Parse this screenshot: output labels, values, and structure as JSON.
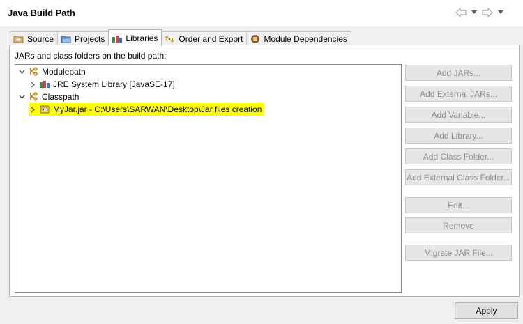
{
  "window": {
    "title": "Java Build Path"
  },
  "tabs": [
    {
      "label": "Source",
      "icon": "source-folder-icon",
      "active": false
    },
    {
      "label": "Projects",
      "icon": "projects-icon",
      "active": false
    },
    {
      "label": "Libraries",
      "icon": "libraries-icon",
      "active": true
    },
    {
      "label": "Order and Export",
      "icon": "order-export-icon",
      "active": false
    },
    {
      "label": "Module Dependencies",
      "icon": "module-dependencies-icon",
      "active": false
    }
  ],
  "panel": {
    "label": "JARs and class folders on the build path:"
  },
  "tree": {
    "modulepath": {
      "label": "Modulepath",
      "icon": "modulepath-icon",
      "expanded": true
    },
    "jre": {
      "label": "JRE System Library [JavaSE-17]",
      "icon": "library-icon"
    },
    "classpath": {
      "label": "Classpath",
      "icon": "classpath-icon",
      "expanded": true
    },
    "myjar": {
      "label": "MyJar.jar - C:\\Users\\SARWAN\\Desktop\\Jar files creation",
      "icon": "jar-icon",
      "highlight_color": "#ffff00"
    }
  },
  "buttons": {
    "add_jars": "Add JARs...",
    "add_external_jars": "Add External JARs...",
    "add_variable": "Add Variable...",
    "add_library": "Add Library...",
    "add_class_folder": "Add Class Folder...",
    "add_external_class_folder": "Add External Class Folder...",
    "edit": "Edit...",
    "remove": "Remove",
    "migrate_jar": "Migrate JAR File..."
  },
  "footer": {
    "apply": "Apply"
  },
  "colors": {
    "disabled_text": "#8c8c8c",
    "highlight": "#ffff00"
  }
}
